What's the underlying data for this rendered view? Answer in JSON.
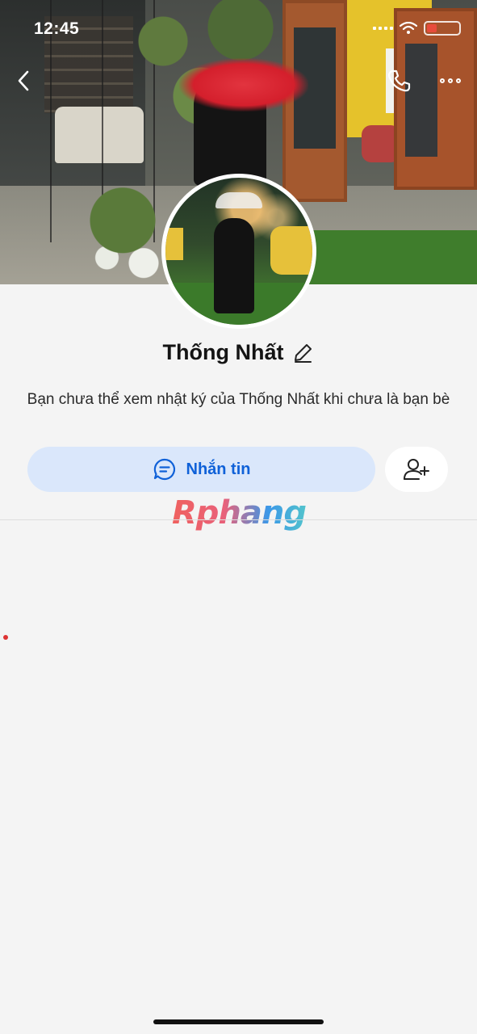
{
  "status_bar": {
    "time": "12:45"
  },
  "profile": {
    "name": "Thống Nhất",
    "notice": "Bạn chưa thể xem nhật ký của Thống Nhất khi chưa là bạn bè"
  },
  "actions": {
    "message_label": "Nhắn tin"
  },
  "watermark": "Rphang",
  "icons": {
    "back": "chevron-left-icon",
    "call": "phone-icon",
    "more": "more-horizontal-icon",
    "edit": "pencil-icon",
    "message": "chat-bubble-icon",
    "add_friend": "add-user-icon"
  },
  "colors": {
    "accent": "#0f61d8",
    "message_button_bg": "#dae7fb",
    "background": "#f4f4f4"
  }
}
